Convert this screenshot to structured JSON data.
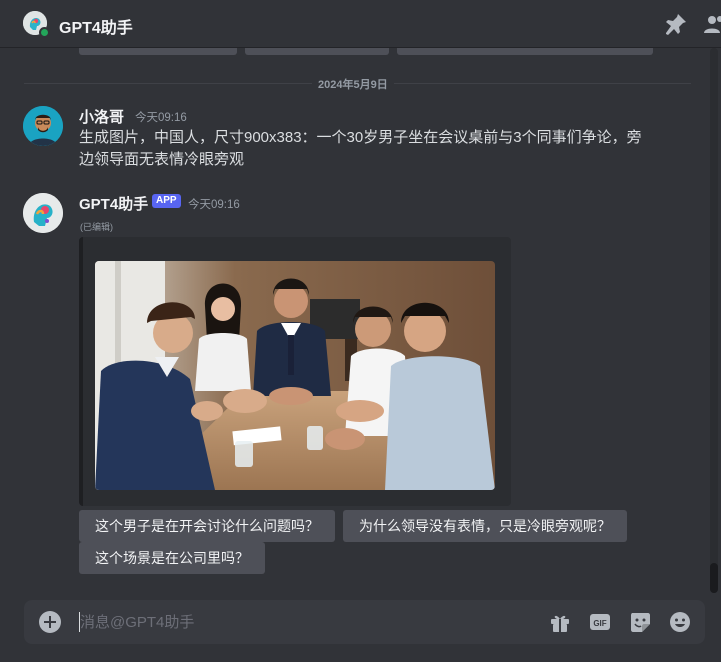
{
  "header": {
    "title": "GPT4助手"
  },
  "date_divider": "2024年5月9日",
  "messages": [
    {
      "author": "小洛哥",
      "time": "今天09:16",
      "text": "生成图片，中国人，尺寸900x383：一个30岁男子坐在会议桌前与3个同事们争论，旁边领导面无表情冷眼旁观"
    },
    {
      "author": "GPT4助手",
      "badge": "APP",
      "time": "今天09:16",
      "edited": "(已编辑)"
    }
  ],
  "suggestions": [
    "这个男子是在开会讨论什么问题吗？",
    "为什么领导没有表情，只是冷眼旁观呢？",
    "这个场景是在公司里吗？"
  ],
  "composer": {
    "placeholder": "消息@GPT4助手"
  },
  "icons": [
    "pin-icon",
    "members-icon",
    "add-icon",
    "gift-icon",
    "gif-icon",
    "sticker-icon",
    "emoji-icon"
  ],
  "colors": {
    "background": "#313338",
    "accent": "#5865f2",
    "online": "#23a55a"
  }
}
